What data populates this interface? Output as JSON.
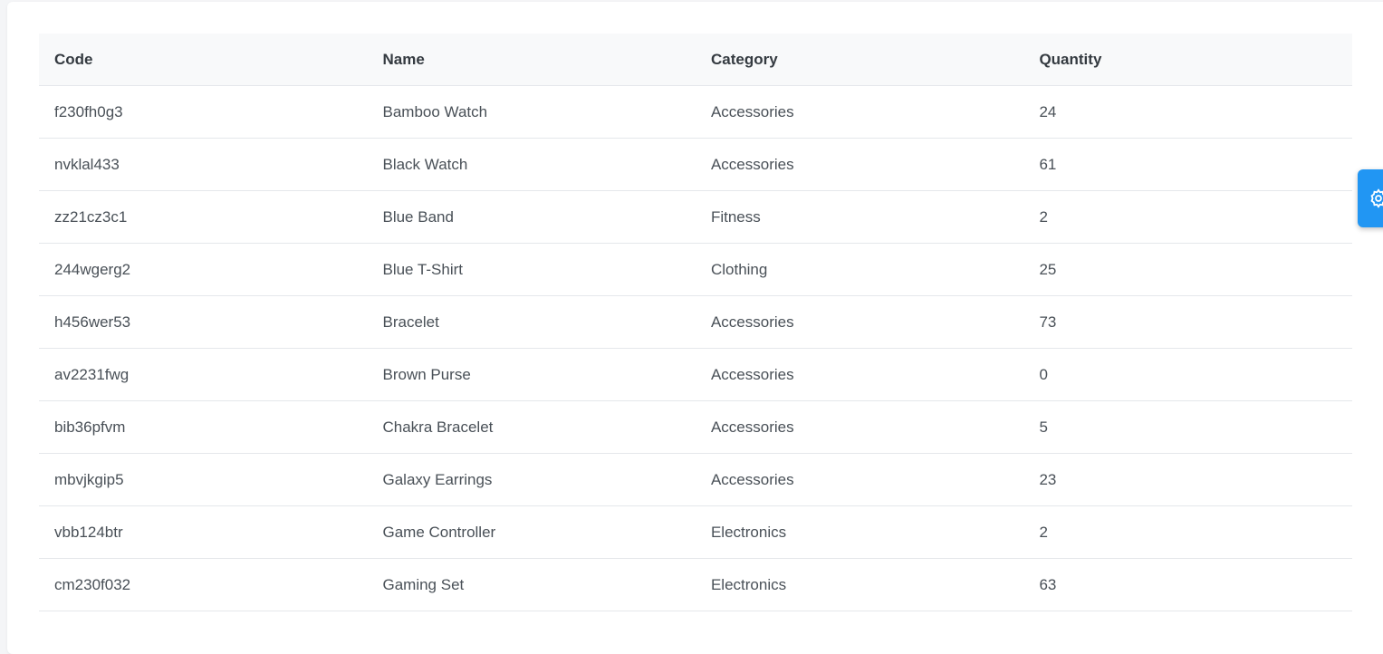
{
  "table": {
    "headers": [
      "Code",
      "Name",
      "Category",
      "Quantity"
    ],
    "rows": [
      [
        "f230fh0g3",
        "Bamboo Watch",
        "Accessories",
        "24"
      ],
      [
        "nvklal433",
        "Black Watch",
        "Accessories",
        "61"
      ],
      [
        "zz21cz3c1",
        "Blue Band",
        "Fitness",
        "2"
      ],
      [
        "244wgerg2",
        "Blue T-Shirt",
        "Clothing",
        "25"
      ],
      [
        "h456wer53",
        "Bracelet",
        "Accessories",
        "73"
      ],
      [
        "av2231fwg",
        "Brown Purse",
        "Accessories",
        "0"
      ],
      [
        "bib36pfvm",
        "Chakra Bracelet",
        "Accessories",
        "5"
      ],
      [
        "mbvjkgip5",
        "Galaxy Earrings",
        "Accessories",
        "23"
      ],
      [
        "vbb124btr",
        "Game Controller",
        "Electronics",
        "2"
      ],
      [
        "cm230f032",
        "Gaming Set",
        "Electronics",
        "63"
      ]
    ]
  },
  "config_button": {
    "icon": "gear-icon",
    "color": "#2196f3"
  }
}
